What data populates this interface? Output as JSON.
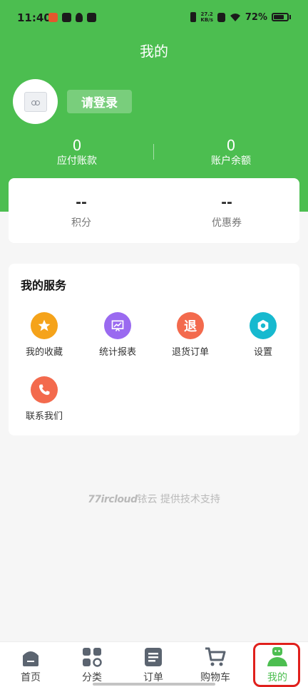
{
  "status_bar": {
    "time": "11:40",
    "speed_value": "27.2",
    "speed_unit": "KB/s",
    "battery": "72%"
  },
  "header": {
    "title": "我的",
    "login_label": "请登录"
  },
  "account": {
    "payable": {
      "value": "0",
      "label": "应付账款"
    },
    "balance": {
      "value": "0",
      "label": "账户余额"
    }
  },
  "points": {
    "score": {
      "value": "--",
      "label": "积分"
    },
    "coupons": {
      "value": "--",
      "label": "优惠券"
    }
  },
  "services": {
    "title": "我的服务",
    "items": [
      {
        "label": "我的收藏",
        "icon": "star-icon",
        "color": "#f5a31a"
      },
      {
        "label": "统计报表",
        "icon": "chart-icon",
        "color": "#9a6af0"
      },
      {
        "label": "退货订单",
        "icon": "return-icon",
        "glyph": "退",
        "color": "#f36a4d"
      },
      {
        "label": "设置",
        "icon": "settings-icon",
        "color": "#17b9cf"
      },
      {
        "label": "联系我们",
        "icon": "phone-icon",
        "color": "#f36a4d"
      }
    ]
  },
  "footer": {
    "brand": "77ircloud",
    "brand_cn": "铱云",
    "support": "提供技术支持"
  },
  "tabbar": {
    "items": [
      {
        "label": "首页",
        "icon": "home-icon"
      },
      {
        "label": "分类",
        "icon": "category-icon"
      },
      {
        "label": "订单",
        "icon": "order-icon"
      },
      {
        "label": "购物车",
        "icon": "cart-icon"
      },
      {
        "label": "我的",
        "icon": "profile-icon",
        "active": true
      }
    ],
    "active_color": "#4cbe50",
    "inactive_color": "#5b6470"
  },
  "colors": {
    "brand_green": "#4cbe50",
    "highlight_red": "#e0201c"
  }
}
